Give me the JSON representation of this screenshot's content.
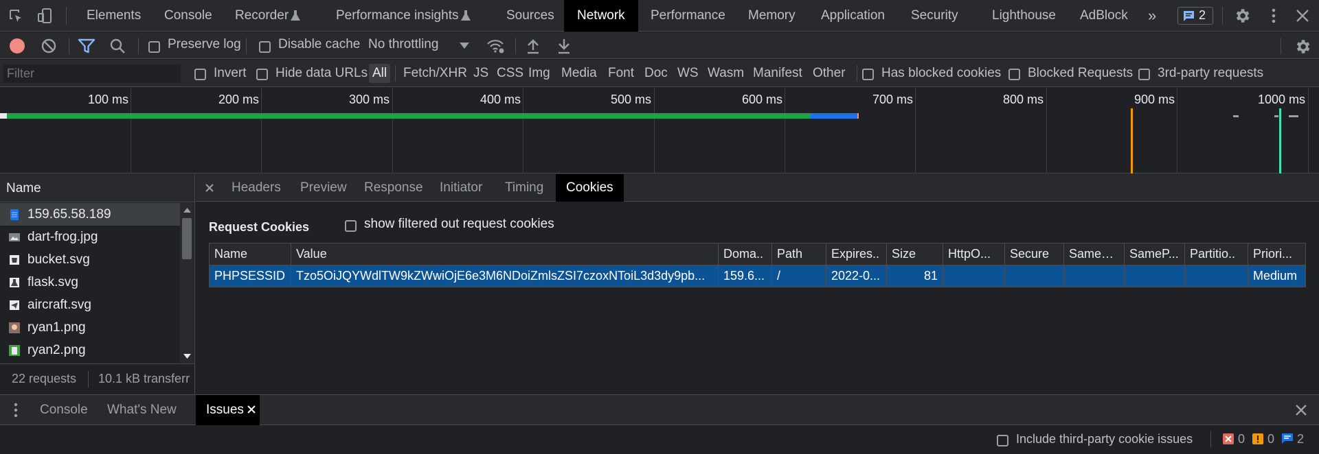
{
  "top_tabs": [
    "Elements",
    "Console",
    "Recorder",
    "Performance insights",
    "Sources",
    "Network",
    "Performance",
    "Memory",
    "Application",
    "Security",
    "Lighthouse",
    "AdBlock"
  ],
  "active_tab": "Network",
  "issues_badge_count": "2",
  "toolbar": {
    "preserve_log": "Preserve log",
    "disable_cache": "Disable cache",
    "throttling": "No throttling"
  },
  "filter": {
    "placeholder": "Filter",
    "invert": "Invert",
    "hide_data_urls": "Hide data URLs",
    "types": [
      "All",
      "Fetch/XHR",
      "JS",
      "CSS",
      "Img",
      "Media",
      "Font",
      "Doc",
      "WS",
      "Wasm",
      "Manifest",
      "Other"
    ],
    "has_blocked_cookies": "Has blocked cookies",
    "blocked_requests": "Blocked Requests",
    "third_party": "3rd-party requests"
  },
  "timeline_ticks": [
    "100 ms",
    "200 ms",
    "300 ms",
    "400 ms",
    "500 ms",
    "600 ms",
    "700 ms",
    "800 ms",
    "900 ms",
    "1000 ms"
  ],
  "requests": {
    "header": "Name",
    "items": [
      {
        "name": "159.65.58.189",
        "icon": "document-icon"
      },
      {
        "name": "dart-frog.jpg",
        "icon": "image-icon"
      },
      {
        "name": "bucket.svg",
        "icon": "svg-icon"
      },
      {
        "name": "flask.svg",
        "icon": "svg-icon"
      },
      {
        "name": "aircraft.svg",
        "icon": "svg-icon"
      },
      {
        "name": "ryan1.png",
        "icon": "image-icon"
      },
      {
        "name": "ryan2.png",
        "icon": "image-icon"
      }
    ],
    "summary_count": "22 requests",
    "summary_transfer": "10.1 kB transferr"
  },
  "detail_tabs": [
    "Headers",
    "Preview",
    "Response",
    "Initiator",
    "Timing",
    "Cookies"
  ],
  "active_detail_tab": "Cookies",
  "cookies": {
    "section_title": "Request Cookies",
    "show_filtered": "show filtered out request cookies",
    "columns": [
      "Name",
      "Value",
      "Doma..",
      "Path",
      "Expires..",
      "Size",
      "HttpO...",
      "Secure",
      "SameS...",
      "SameP...",
      "Partitio..",
      "Priori..."
    ],
    "row": [
      "PHPSESSID",
      "Tzo5OiJQYWdlTW9kZWwiOjE6e3M6NDoiZmlsZSI7czoxNToiL3d3dy9pb...",
      "159.6...",
      "/",
      "2022-0...",
      "81",
      "",
      "",
      "",
      "",
      "",
      "Medium"
    ]
  },
  "drawer": {
    "tabs": [
      "Console",
      "What's New",
      "Issues"
    ],
    "active": "Issues",
    "include_third_party": "Include third-party cookie issues",
    "errors": "0",
    "warnings": "0",
    "infos": "2"
  },
  "colors": {
    "background": "#202124",
    "toolbar": "#292a2d",
    "selected_row": "#0b5394",
    "accent_blue": "#8ab4f8",
    "record_red": "#f28b82"
  }
}
